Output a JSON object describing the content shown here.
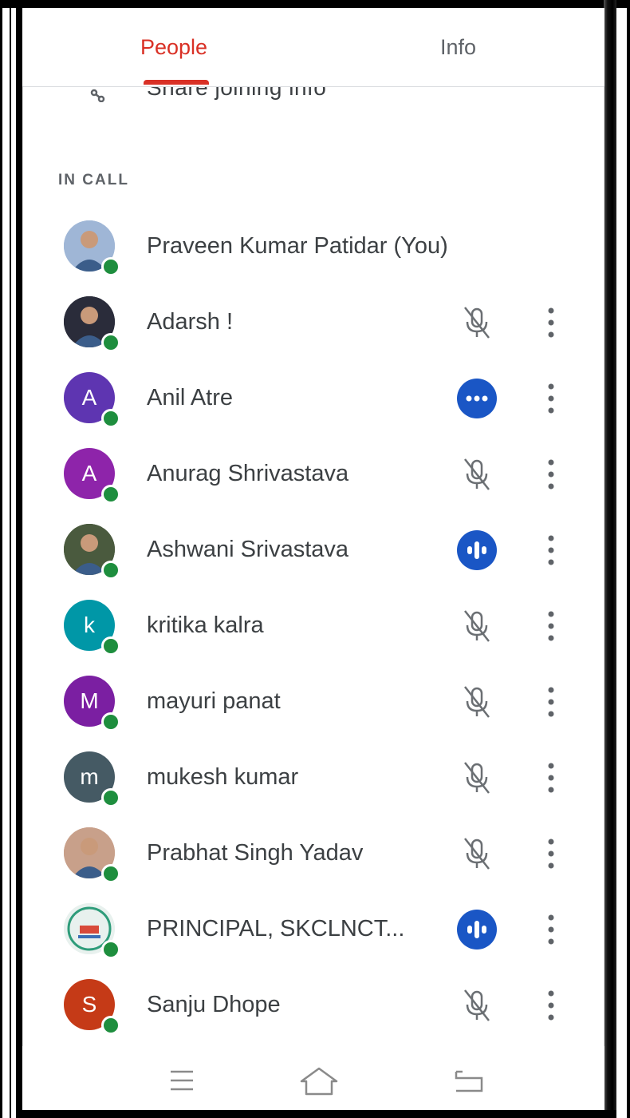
{
  "tabs": [
    {
      "label": "People",
      "active": true
    },
    {
      "label": "Info",
      "active": false
    }
  ],
  "share": {
    "label": "Share joining info",
    "icon": "link-icon"
  },
  "section_label": "IN CALL",
  "colors": {
    "accent": "#d93025",
    "presence": "#1e8e3e",
    "speaking": "#1a56c5"
  },
  "participants": [
    {
      "name": "Praveen Kumar Patidar (You)",
      "avatar": "photo",
      "avatar_bg": "#9fb6d6",
      "status": "none"
    },
    {
      "name": "Adarsh !",
      "avatar": "photo",
      "avatar_bg": "#2a2c3a",
      "status": "muted"
    },
    {
      "name": "Anil Atre",
      "avatar": "letter",
      "letter": "A",
      "avatar_bg": "#5e35b1",
      "status": "connecting"
    },
    {
      "name": "Anurag Shrivastava",
      "avatar": "letter",
      "letter": "A",
      "avatar_bg": "#8e24aa",
      "status": "muted"
    },
    {
      "name": "Ashwani Srivastava",
      "avatar": "photo",
      "avatar_bg": "#4a5a3e",
      "status": "speaking"
    },
    {
      "name": "kritika kalra",
      "avatar": "letter",
      "letter": "k",
      "avatar_bg": "#0097a7",
      "status": "muted"
    },
    {
      "name": "mayuri panat",
      "avatar": "letter",
      "letter": "M",
      "avatar_bg": "#7b1fa2",
      "status": "muted"
    },
    {
      "name": "mukesh kumar",
      "avatar": "letter",
      "letter": "m",
      "avatar_bg": "#455a64",
      "status": "muted"
    },
    {
      "name": "Prabhat Singh Yadav",
      "avatar": "photo",
      "avatar_bg": "#c8a08a",
      "status": "muted"
    },
    {
      "name": "PRINCIPAL, SKCLNCT...",
      "avatar": "logo",
      "avatar_bg": "#e8f1ee",
      "status": "speaking"
    },
    {
      "name": "Sanju Dhope",
      "avatar": "letter",
      "letter": "S",
      "avatar_bg": "#c53a17",
      "status": "muted"
    }
  ],
  "navbar": [
    {
      "icon": "menu-icon"
    },
    {
      "icon": "home-icon"
    },
    {
      "icon": "back-icon"
    }
  ]
}
